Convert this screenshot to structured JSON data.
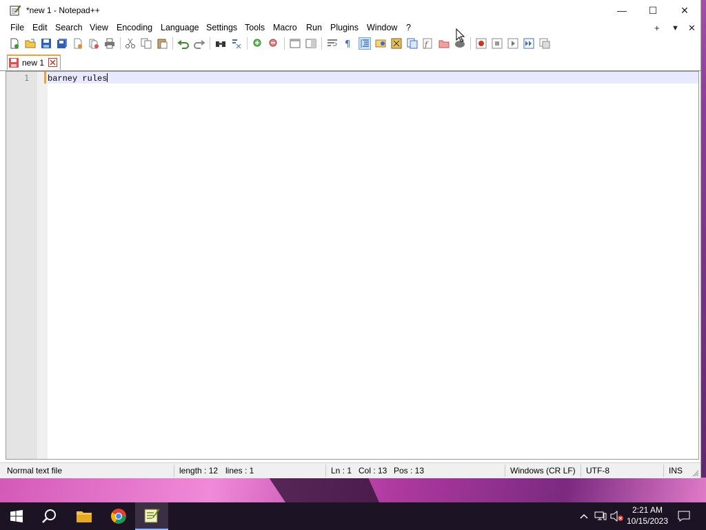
{
  "window": {
    "title": "*new 1 - Notepad++"
  },
  "title_controls": {
    "minimize": "—",
    "maximize": "☐",
    "close": "✕"
  },
  "menu": {
    "items": [
      "File",
      "Edit",
      "Search",
      "View",
      "Encoding",
      "Language",
      "Settings",
      "Tools",
      "Macro",
      "Run",
      "Plugins",
      "Window",
      "?"
    ],
    "right": {
      "add": "+",
      "dropdown": "▼",
      "close": "✕"
    }
  },
  "toolbar": {
    "icons": [
      "new-file",
      "open-file",
      "save",
      "save-all",
      "close",
      "close-all",
      "print",
      "cut",
      "copy",
      "paste",
      "undo",
      "redo",
      "find",
      "replace",
      "zoom-in",
      "zoom-out",
      "sync-vertical",
      "sync-horizontal",
      "word-wrap",
      "show-all-characters",
      "indent-guide",
      "user-defined-language",
      "doc-map",
      "document-list",
      "function-list",
      "folder-as-workspace",
      "monitoring",
      "record-macro",
      "stop-recording",
      "playback-macro",
      "run-macro-multiple",
      "save-macro"
    ]
  },
  "tabs": [
    {
      "label": "new 1",
      "modified": true
    }
  ],
  "editor": {
    "line_number": "1",
    "text": "barney rules"
  },
  "status": {
    "file_type": "Normal text file",
    "length": "length : 12",
    "lines": "lines : 1",
    "ln": "Ln : 1",
    "col": "Col : 13",
    "pos": "Pos : 13",
    "eol": "Windows (CR LF)",
    "encoding": "UTF-8",
    "mode": "INS"
  },
  "taskbar": {
    "apps": [
      "start-icon",
      "search-icon",
      "file-explorer-icon",
      "chrome-icon",
      "notepadpp-icon"
    ],
    "clock_time": "2:21 AM",
    "clock_date": "10/15/2023"
  },
  "colors": {
    "accent_tab": "#f6a13a",
    "current_line": "#e8e8ff",
    "taskbar": "#1c1424"
  }
}
